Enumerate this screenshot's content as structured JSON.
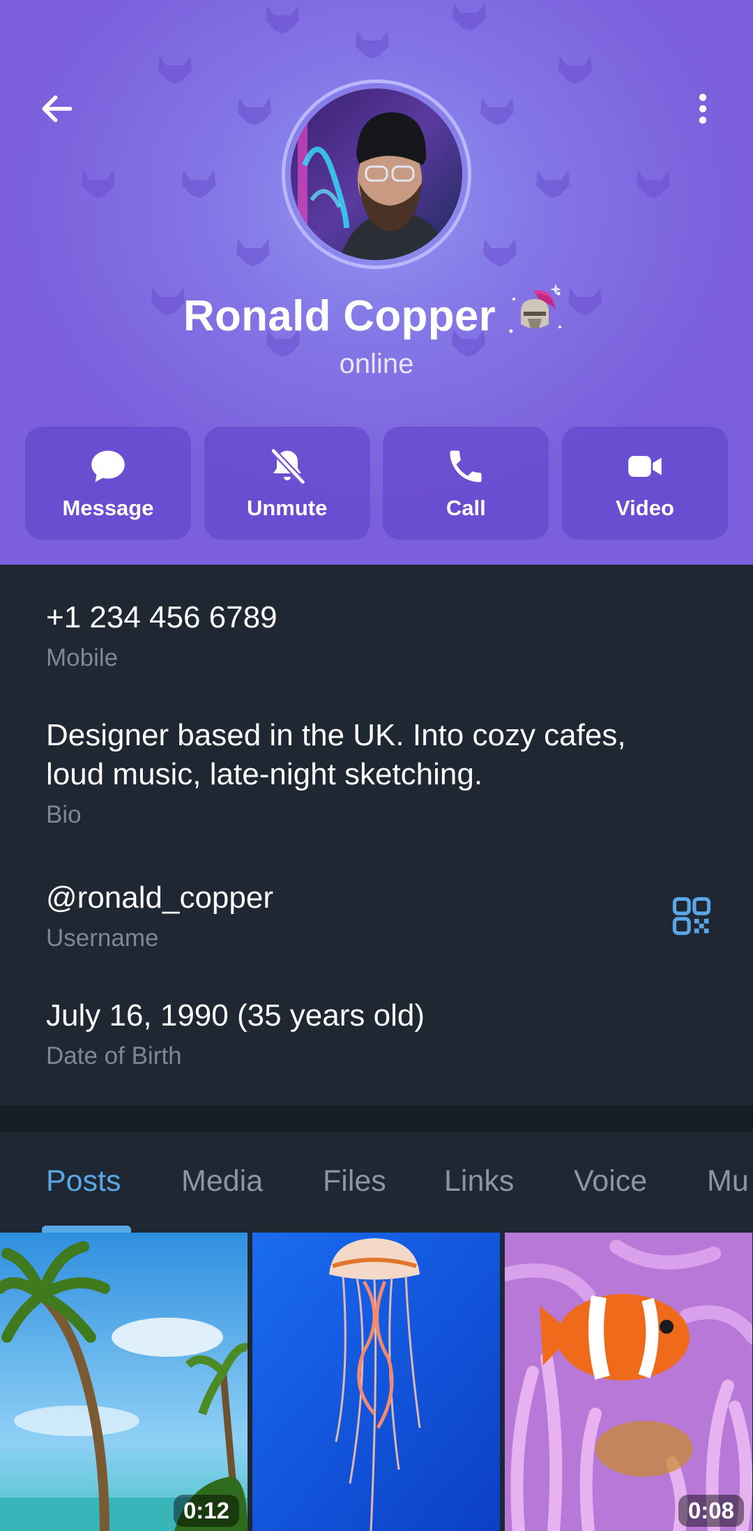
{
  "profile": {
    "name": "Ronald Copper",
    "status": "online",
    "emoji_status_icon": "knight-helmet-emoji-icon",
    "avatar_icon": "profile-photo"
  },
  "header": {
    "back_icon": "arrow-left-icon",
    "more_icon": "more-vertical-icon",
    "background_colors": [
      "#8f96f0",
      "#8476e6",
      "#7b5fdc"
    ]
  },
  "actions": [
    {
      "label": "Message",
      "icon": "message-bubble-icon"
    },
    {
      "label": "Unmute",
      "icon": "bell-off-icon"
    },
    {
      "label": "Call",
      "icon": "phone-icon"
    },
    {
      "label": "Video",
      "icon": "video-camera-icon"
    }
  ],
  "info": {
    "phone": {
      "value": "+1 234 456 6789",
      "label": "Mobile"
    },
    "bio": {
      "line1": "Designer based in the UK. Into cozy cafes,",
      "line2": "loud music, late-night sketching.",
      "label": "Bio"
    },
    "username": {
      "value": "@ronald_copper",
      "label": "Username",
      "icon": "qr-code-icon"
    },
    "birthday": {
      "value": "July 16, 1990 (35 years old)",
      "label": "Date of Birth"
    }
  },
  "tabs": [
    {
      "label": "Posts",
      "active": true
    },
    {
      "label": "Media",
      "active": false
    },
    {
      "label": "Files",
      "active": false
    },
    {
      "label": "Links",
      "active": false
    },
    {
      "label": "Voice",
      "active": false
    },
    {
      "label": "Mu",
      "active": false
    }
  ],
  "media": [
    {
      "thumbnail": "palm-tree-beach",
      "duration": "0:12"
    },
    {
      "thumbnail": "jellyfish",
      "duration": ""
    },
    {
      "thumbnail": "clownfish-anemone",
      "duration": "0:08"
    }
  ],
  "colors": {
    "accent": "#5aa7e8",
    "background": "#1f2732",
    "muted_text": "#7d8895"
  }
}
